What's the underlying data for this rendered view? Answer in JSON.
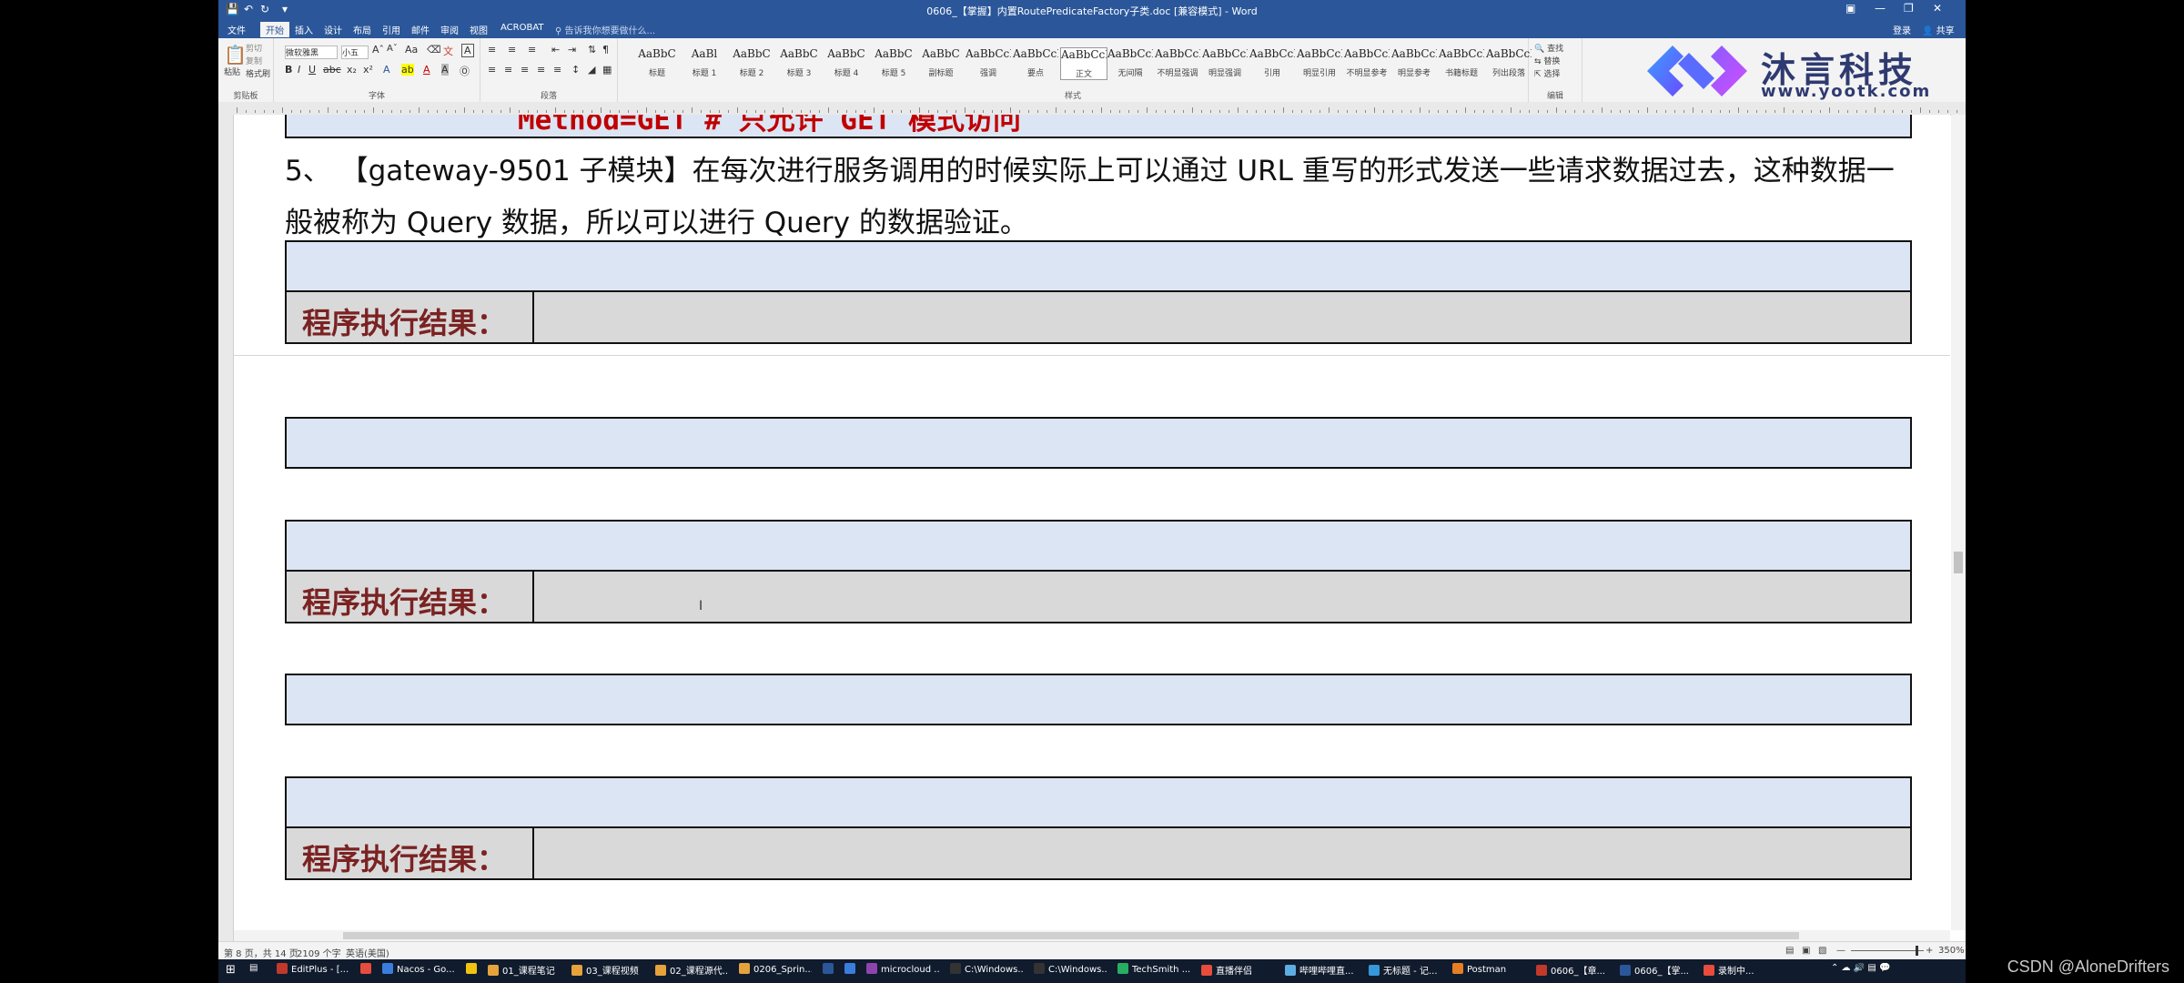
{
  "window": {
    "title": "0606_【掌握】内置RoutePredicateFactory子类.doc [兼容模式] - Word",
    "login": "登录",
    "share": "共享"
  },
  "ribbon_tabs": [
    "文件",
    "开始",
    "插入",
    "设计",
    "布局",
    "引用",
    "邮件",
    "审阅",
    "视图",
    "ACROBAT"
  ],
  "tell_me": "告诉我你想要做什么...",
  "clipboard": {
    "paste": "粘贴",
    "cut": "剪切",
    "copy": "复制",
    "format_painter": "格式刷",
    "label": "剪贴板"
  },
  "font": {
    "name": "微软雅黑",
    "size": "小五",
    "label": "字体"
  },
  "paragraph": {
    "label": "段落"
  },
  "styles": {
    "label": "样式",
    "items": [
      {
        "preview": "AaBbC",
        "name": "标题"
      },
      {
        "preview": "AaBl",
        "name": "标题 1"
      },
      {
        "preview": "AaBbC",
        "name": "标题 2"
      },
      {
        "preview": "AaBbC",
        "name": "标题 3"
      },
      {
        "preview": "AaBbC",
        "name": "标题 4"
      },
      {
        "preview": "AaBbC",
        "name": "标题 5"
      },
      {
        "preview": "AaBbC",
        "name": "副标题"
      },
      {
        "preview": "AaBbCcDı",
        "name": "强调"
      },
      {
        "preview": "AaBbCcD",
        "name": "要点"
      },
      {
        "preview": "AaBbCcDc",
        "name": "正文"
      },
      {
        "preview": "AaBbCcDc",
        "name": "无间隔"
      },
      {
        "preview": "AaBbCcDc",
        "name": "不明显强调"
      },
      {
        "preview": "AaBbCcDı",
        "name": "明显强调"
      },
      {
        "preview": "AaBbCcDc",
        "name": "引用"
      },
      {
        "preview": "AaBbCcDc",
        "name": "明显引用"
      },
      {
        "preview": "AaBbCcD",
        "name": "不明显参考"
      },
      {
        "preview": "AaBbCcI",
        "name": "明显参考"
      },
      {
        "preview": "AaBbCcD",
        "name": "书籍标题"
      },
      {
        "preview": "AaBbCcDc",
        "name": "列出段落"
      }
    ]
  },
  "editing": {
    "find": "查找",
    "replace": "替换",
    "select": "选择",
    "label": "编辑"
  },
  "logo": {
    "brand": "沐言科技",
    "url": "www.yootk.com"
  },
  "document": {
    "top_fragment": "Method=GET # 只允许 GET 模式访问",
    "paragraph_line1": "5、  【gateway-9501 子模块】在每次进行服务调用的时候实际上可以通过 URL 重写的形式发送一些请求数据过去，这种数据一",
    "paragraph_line2": "般被称为 Query 数据，所以可以进行 Query 的数据验证。",
    "result_label": "程序执行结果："
  },
  "status": {
    "page": "第 8 页，共 14 页",
    "words": "2109 个字",
    "lang": "英语(美国)",
    "zoom": "350%"
  },
  "taskbar": [
    "EditPlus - [...",
    "",
    "Nacos - Go...",
    "",
    "01_课程笔记",
    "03_课程视频",
    "02_课程源代...",
    "0206_Sprin...",
    "",
    "",
    "microcloud ...",
    "C:\\Windows...",
    "C:\\Windows...",
    "TechSmith ...",
    "直播伴侣",
    "哔哩哔哩直...",
    "无标题 - 记...",
    "Postman",
    "0606_【章...",
    "0606_【掌...",
    "录制中..."
  ],
  "watermark": "CSDN @AloneDrifters"
}
